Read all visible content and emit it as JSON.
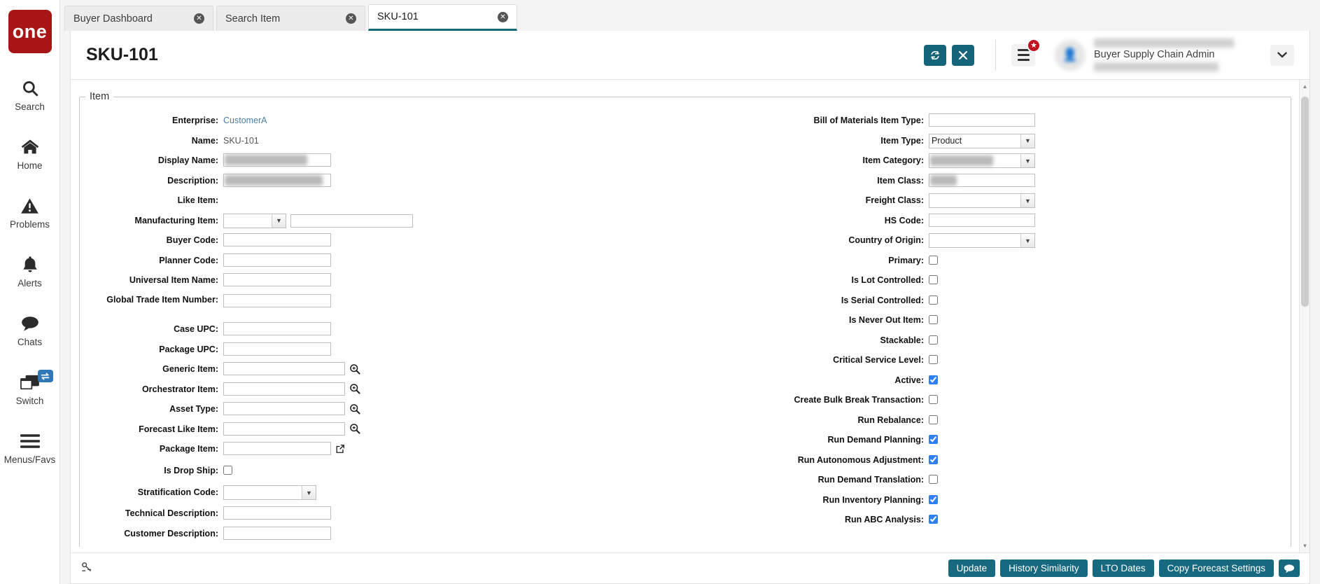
{
  "brand": {
    "logo_text": "one",
    "logo_color": "#a81517",
    "accent_color": "#16697f",
    "tab_active_underline": "#136b7a"
  },
  "rail": {
    "items": [
      {
        "label": "Search",
        "icon": "search-icon"
      },
      {
        "label": "Home",
        "icon": "home-icon"
      },
      {
        "label": "Problems",
        "icon": "warning-triangle-icon"
      },
      {
        "label": "Alerts",
        "icon": "bell-icon"
      },
      {
        "label": "Chats",
        "icon": "chat-bubble-icon"
      },
      {
        "label": "Switch",
        "icon": "windows-stack-icon",
        "badge_icon": "swap-arrows-icon"
      },
      {
        "label": "Menus/Favs",
        "icon": "hamburger-icon"
      }
    ]
  },
  "tabs": [
    {
      "label": "Buyer Dashboard",
      "active": false,
      "close_icon": "close-circle-icon"
    },
    {
      "label": "Search Item",
      "active": false,
      "close_icon": "close-circle-icon"
    },
    {
      "label": "SKU-101",
      "active": true,
      "close_icon": "close-circle-icon"
    }
  ],
  "header": {
    "title": "SKU-101",
    "refresh_icon": "refresh-icon",
    "close_icon": "close-x-icon",
    "menu_icon": "hamburger-icon",
    "menu_badge_icon": "star-icon",
    "avatar_icon": "avatar",
    "user_name": "Buyer Supply Chain Admin",
    "caret_icon": "chevron-down-icon"
  },
  "form": {
    "legend": "Item",
    "left": [
      {
        "label": "Enterprise:",
        "type": "link",
        "value": "CustomerA"
      },
      {
        "label": "Name:",
        "type": "text-static",
        "value": "SKU-101"
      },
      {
        "label": "Display Name:",
        "type": "input-blurred",
        "value": ""
      },
      {
        "label": "Description:",
        "type": "input-blurred",
        "value": ""
      },
      {
        "label": "Like Item:",
        "type": "empty",
        "value": ""
      },
      {
        "label": "Manufacturing Item:",
        "type": "select-plus-input",
        "value": ""
      },
      {
        "label": "Buyer Code:",
        "type": "input",
        "value": ""
      },
      {
        "label": "Planner Code:",
        "type": "input",
        "value": ""
      },
      {
        "label": "Universal Item Name:",
        "type": "input",
        "value": ""
      },
      {
        "label": "Global Trade Item Number:",
        "type": "input",
        "value": ""
      },
      {
        "label": "Case UPC:",
        "type": "input",
        "value": ""
      },
      {
        "label": "Package UPC:",
        "type": "input",
        "value": ""
      },
      {
        "label": "Generic Item:",
        "type": "input-lookup",
        "value": ""
      },
      {
        "label": "Orchestrator Item:",
        "type": "input-lookup",
        "value": ""
      },
      {
        "label": "Asset Type:",
        "type": "input-lookup",
        "value": ""
      },
      {
        "label": "Forecast Like Item:",
        "type": "input-lookup",
        "value": ""
      },
      {
        "label": "Package Item:",
        "type": "input-external",
        "value": ""
      },
      {
        "label": "Is Drop Ship:",
        "type": "checkbox",
        "checked": false
      },
      {
        "label": "Stratification Code:",
        "type": "select",
        "value": ""
      },
      {
        "label": "Technical Description:",
        "type": "input",
        "value": ""
      },
      {
        "label": "Customer Description:",
        "type": "input",
        "value": ""
      }
    ],
    "right": [
      {
        "label": "Bill of Materials Item Type:",
        "type": "input",
        "value": ""
      },
      {
        "label": "Item Type:",
        "type": "select",
        "value": "Product",
        "options": [
          "Product"
        ]
      },
      {
        "label": "Item Category:",
        "type": "select-blurred",
        "value": ""
      },
      {
        "label": "Item Class:",
        "type": "input-blurred",
        "value": ""
      },
      {
        "label": "Freight Class:",
        "type": "select",
        "value": ""
      },
      {
        "label": "HS Code:",
        "type": "input",
        "value": ""
      },
      {
        "label": "Country of Origin:",
        "type": "select",
        "value": ""
      },
      {
        "label": "Primary:",
        "type": "checkbox",
        "checked": false
      },
      {
        "label": "Is Lot Controlled:",
        "type": "checkbox",
        "checked": false
      },
      {
        "label": "Is Serial Controlled:",
        "type": "checkbox",
        "checked": false
      },
      {
        "label": "Is Never Out Item:",
        "type": "checkbox",
        "checked": false
      },
      {
        "label": "Stackable:",
        "type": "checkbox",
        "checked": false
      },
      {
        "label": "Critical Service Level:",
        "type": "checkbox",
        "checked": false
      },
      {
        "label": "Active:",
        "type": "checkbox",
        "checked": true
      },
      {
        "label": "Create Bulk Break Transaction:",
        "type": "checkbox",
        "checked": false
      },
      {
        "label": "Run Rebalance:",
        "type": "checkbox",
        "checked": false
      },
      {
        "label": "Run Demand Planning:",
        "type": "checkbox",
        "checked": true
      },
      {
        "label": "Run Autonomous Adjustment:",
        "type": "checkbox",
        "checked": true
      },
      {
        "label": "Run Demand Translation:",
        "type": "checkbox",
        "checked": false
      },
      {
        "label": "Run Inventory Planning:",
        "type": "checkbox",
        "checked": true
      },
      {
        "label": "Run ABC Analysis:",
        "type": "checkbox",
        "checked": true
      }
    ]
  },
  "footer": {
    "left_icon": "attachment-icon",
    "buttons": [
      {
        "label": "Update"
      },
      {
        "label": "History Similarity"
      },
      {
        "label": "LTO Dates"
      },
      {
        "label": "Copy Forecast Settings"
      }
    ],
    "chat_icon": "chat-bubble-icon"
  }
}
